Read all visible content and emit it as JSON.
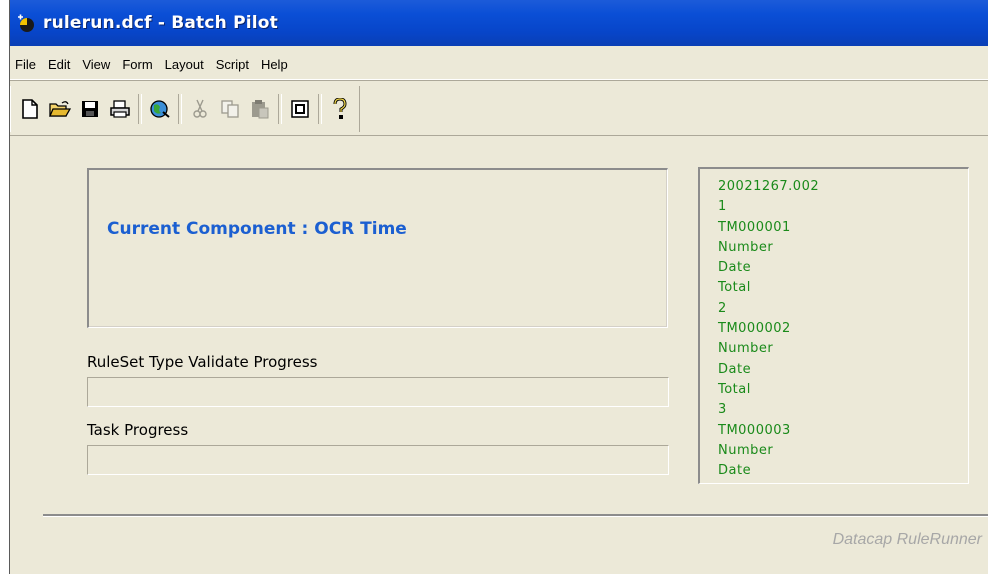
{
  "window": {
    "title": "rulerun.dcf - Batch Pilot"
  },
  "menu": [
    "File",
    "Edit",
    "View",
    "Form",
    "Layout",
    "Script",
    "Help"
  ],
  "toolbar": {
    "buttons": [
      "new-document-icon",
      "open-folder-icon",
      "save-disk-icon",
      "print-icon",
      "globe-icon",
      "cut-icon",
      "copy-icon",
      "paste-icon",
      "window-icon",
      "help-icon"
    ]
  },
  "main": {
    "current_component": "Current Component : OCR Time",
    "ruleset_progress_label": "RuleSet Type Validate Progress",
    "ruleset_progress_value": 0,
    "task_progress_label": "Task Progress",
    "task_progress_value": 0
  },
  "log": {
    "items": [
      "20021267.002",
      "1",
      "TM000001",
      "Number",
      "Date",
      "Total",
      "2",
      "TM000002",
      "Number",
      "Date",
      "Total",
      "3",
      "TM000003",
      "Number",
      "Date"
    ]
  },
  "footer": {
    "brand": "Datacap RuleRunner"
  },
  "colors": {
    "titlebar": "#0b4fd6",
    "component_text": "#1b5fd1",
    "log_text": "#1a8a1a",
    "window_bg": "#ece9d8"
  }
}
